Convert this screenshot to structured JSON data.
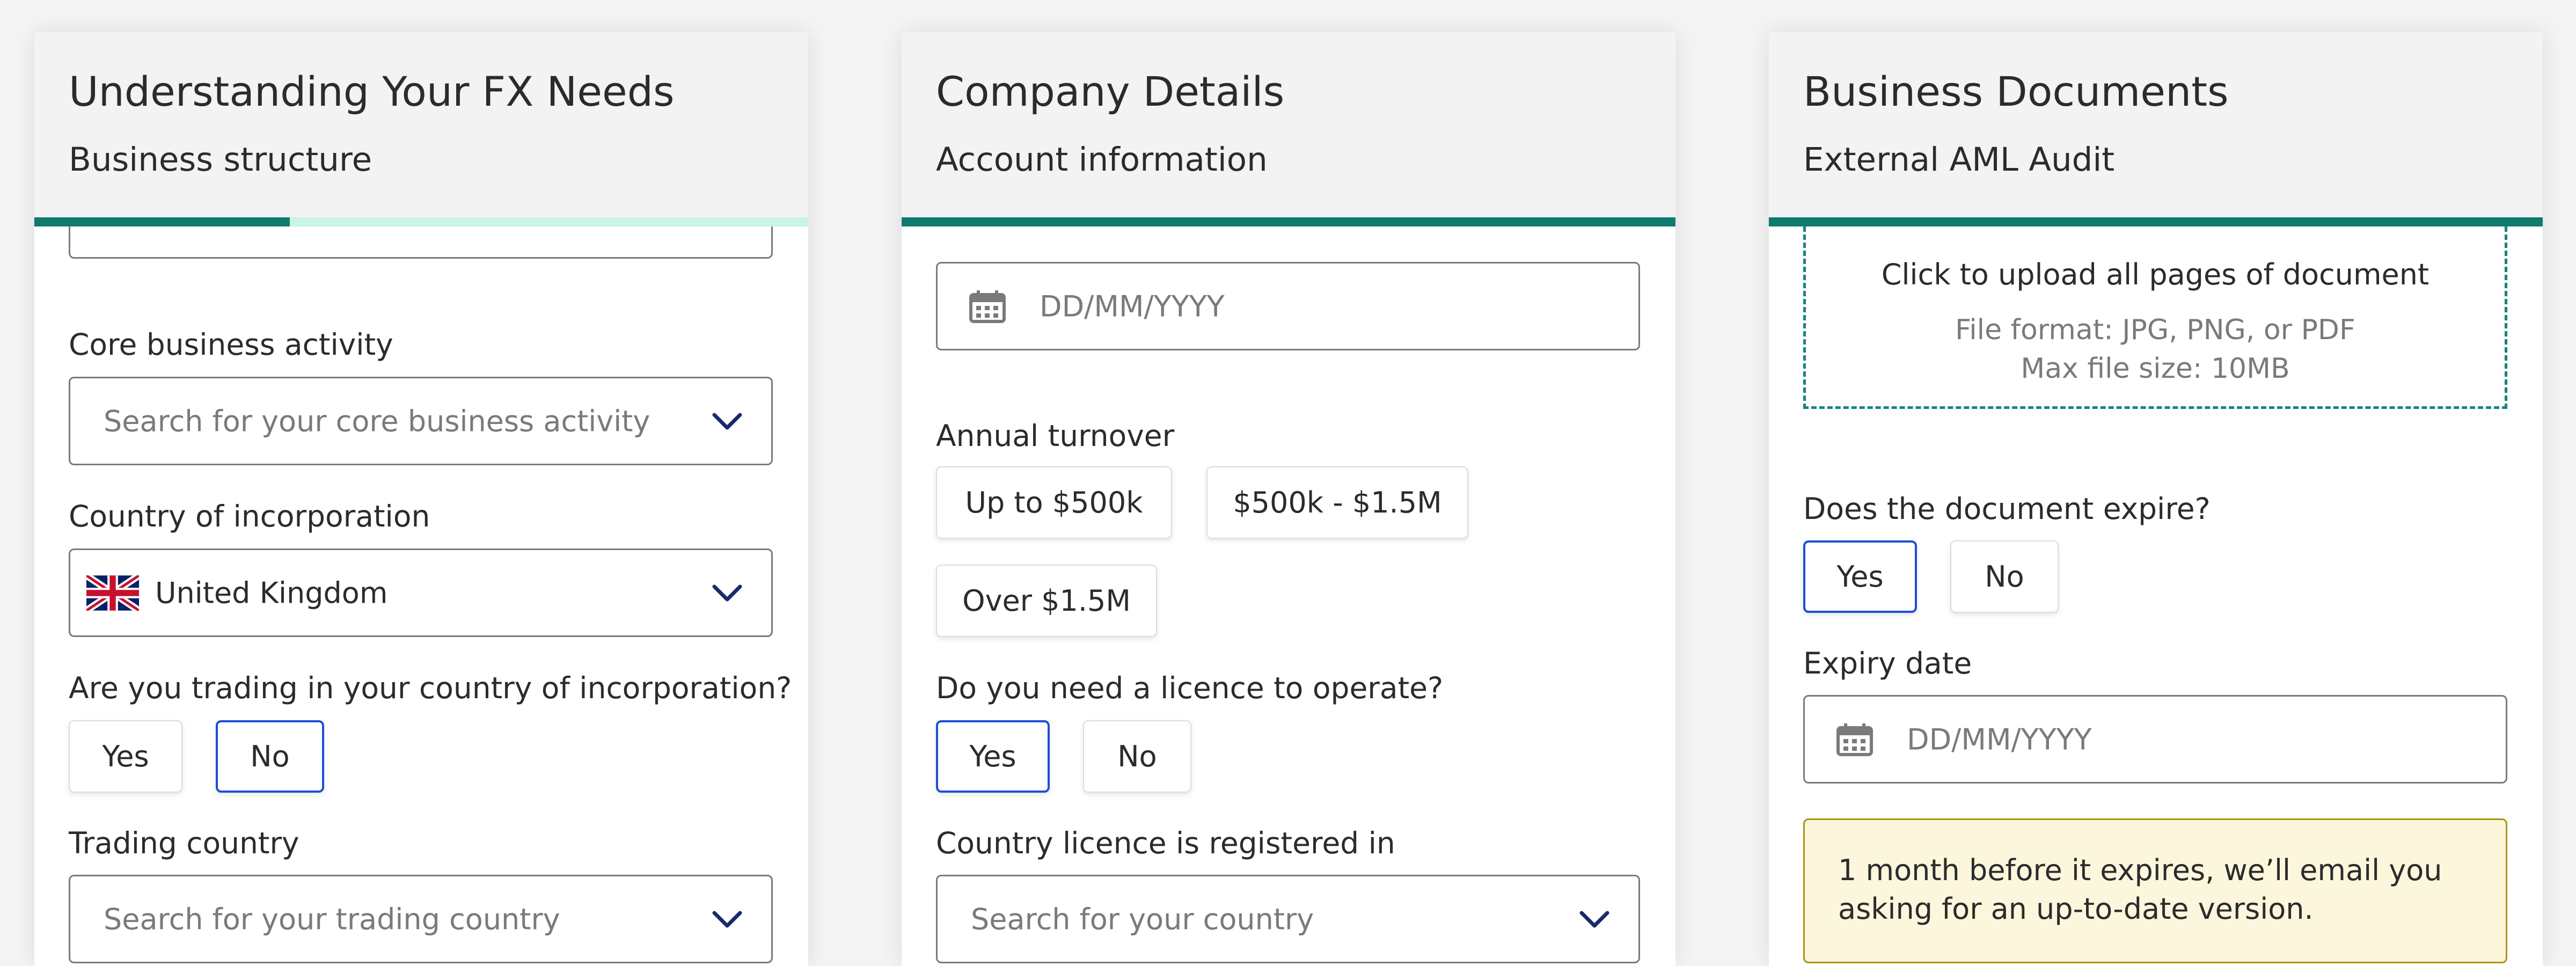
{
  "cards": [
    {
      "title": "Understanding Your FX Needs",
      "subtitle": "Business structure",
      "progress": 0.33,
      "fields": {
        "core_activity_label": "Core business activity",
        "core_activity_placeholder": "Search for your core business activity",
        "country_label": "Country of incorporation",
        "country_value": "United Kingdom",
        "country_flag_icon": "uk-flag-icon",
        "trading_question": "Are you trading in your country of incorporation?",
        "trading_options": [
          "Yes",
          "No"
        ],
        "trading_selected": "No",
        "trading_country_label": "Trading country",
        "trading_country_placeholder": "Search for your trading country"
      }
    },
    {
      "title": "Company Details",
      "subtitle": "Account information",
      "progress": 1.0,
      "fields": {
        "date_placeholder": "DD/MM/YYYY",
        "turnover_label": "Annual turnover",
        "turnover_options": [
          "Up to $500k",
          "$500k - $1.5M",
          "Over $1.5M"
        ],
        "licence_question": "Do you need a licence to operate?",
        "licence_options": [
          "Yes",
          "No"
        ],
        "licence_selected": "Yes",
        "licence_country_label": "Country licence is registered in",
        "licence_country_placeholder": "Search for your country"
      }
    },
    {
      "title": "Business Documents",
      "subtitle": "External AML Audit",
      "progress": 1.0,
      "fields": {
        "upload_title": "Click to upload all pages of document",
        "upload_formats": "File format: JPG, PNG, or PDF",
        "upload_max_size": "Max file size: 10MB",
        "expire_question": "Does the document expire?",
        "expire_options": [
          "Yes",
          "No"
        ],
        "expire_selected": "Yes",
        "expiry_label": "Expiry date",
        "expiry_placeholder": "DD/MM/YYYY",
        "notice_text": "1 month before it expires, we’ll email you asking for an up-to-date version."
      }
    }
  ],
  "colors": {
    "progress_fill": "#0f7a6e",
    "progress_track": "#c9f4e7",
    "selected_border": "#1c4fd6",
    "notice_bg": "#fcf6dc",
    "notice_border": "#a89518",
    "chevron": "#1a2a6c"
  }
}
